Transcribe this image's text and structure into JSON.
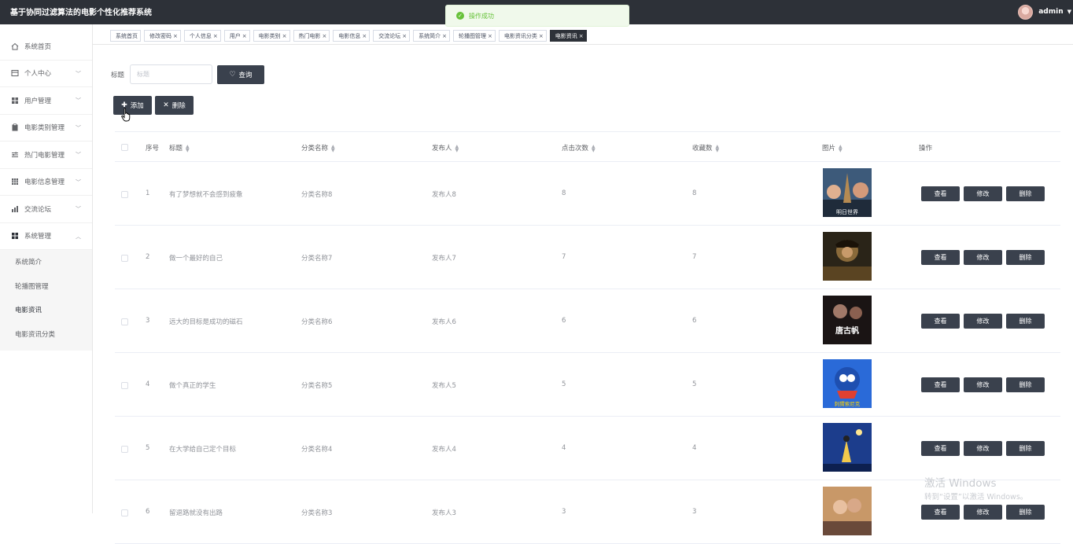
{
  "app": {
    "title": "基于协同过滤算法的电影个性化推荐系统",
    "username": "admin"
  },
  "toast": {
    "text": "操作成功"
  },
  "sidebar": {
    "items": [
      {
        "label": "系统首页",
        "icon": "home-icon"
      },
      {
        "label": "个人中心",
        "icon": "calendar-icon"
      },
      {
        "label": "用户管理",
        "icon": "grid-icon"
      },
      {
        "label": "电影类别管理",
        "icon": "clipboard-icon"
      },
      {
        "label": "热门电影管理",
        "icon": "sliders-icon"
      },
      {
        "label": "电影信息管理",
        "icon": "table-icon"
      },
      {
        "label": "交流论坛",
        "icon": "chart-icon"
      },
      {
        "label": "系统管理",
        "icon": "grid-icon"
      }
    ],
    "sub_items": [
      "系统简介",
      "轮播图管理",
      "电影资讯",
      "电影资讯分类"
    ]
  },
  "tabs": [
    "系统首页",
    "修改密码",
    "个人信息",
    "用户",
    "电影类别",
    "热门电影",
    "电影信息",
    "交流论坛",
    "系统简介",
    "轮播图管理",
    "电影资讯分类",
    "电影资讯"
  ],
  "search": {
    "label": "标题",
    "placeholder": "标题",
    "button": "查询"
  },
  "actions": {
    "add": "添加",
    "delete": "删除"
  },
  "table": {
    "headers": {
      "index": "序号",
      "title": "标题",
      "category": "分类名称",
      "publisher": "发布人",
      "clicks": "点击次数",
      "favorites": "收藏数",
      "image": "图片",
      "ops": "操作"
    },
    "row_actions": {
      "view": "查看",
      "edit": "修改",
      "delete": "删除"
    },
    "rows": [
      {
        "index": "1",
        "title": "有了梦想就不会感到疲惫",
        "category": "分类名称8",
        "publisher": "发布人8",
        "clicks": "8",
        "favorites": "8",
        "poster_text": "明日世界"
      },
      {
        "index": "2",
        "title": "做一个最好的自己",
        "category": "分类名称7",
        "publisher": "发布人7",
        "clicks": "7",
        "favorites": "7",
        "poster_text": ""
      },
      {
        "index": "3",
        "title": "远大的目标是成功的磁石",
        "category": "分类名称6",
        "publisher": "发布人6",
        "clicks": "6",
        "favorites": "6",
        "poster_text": "唐古帆"
      },
      {
        "index": "4",
        "title": "做个真正的学生",
        "category": "分类名称5",
        "publisher": "发布人5",
        "clicks": "5",
        "favorites": "5",
        "poster_text": "刺猬索尼克"
      },
      {
        "index": "5",
        "title": "在大学给自己定个目标",
        "category": "分类名称4",
        "publisher": "发布人4",
        "clicks": "4",
        "favorites": "4",
        "poster_text": ""
      },
      {
        "index": "6",
        "title": "留退路就没有出路",
        "category": "分类名称3",
        "publisher": "发布人3",
        "clicks": "3",
        "favorites": "3",
        "poster_text": ""
      }
    ]
  },
  "watermark": {
    "line1": "激活 Windows",
    "line2": "转到“设置”以激活 Windows。"
  },
  "colors": {
    "topbar": "#2d3138",
    "button": "#3a414d",
    "toast_bg": "#f0f9eb",
    "toast_text": "#67c23a"
  }
}
